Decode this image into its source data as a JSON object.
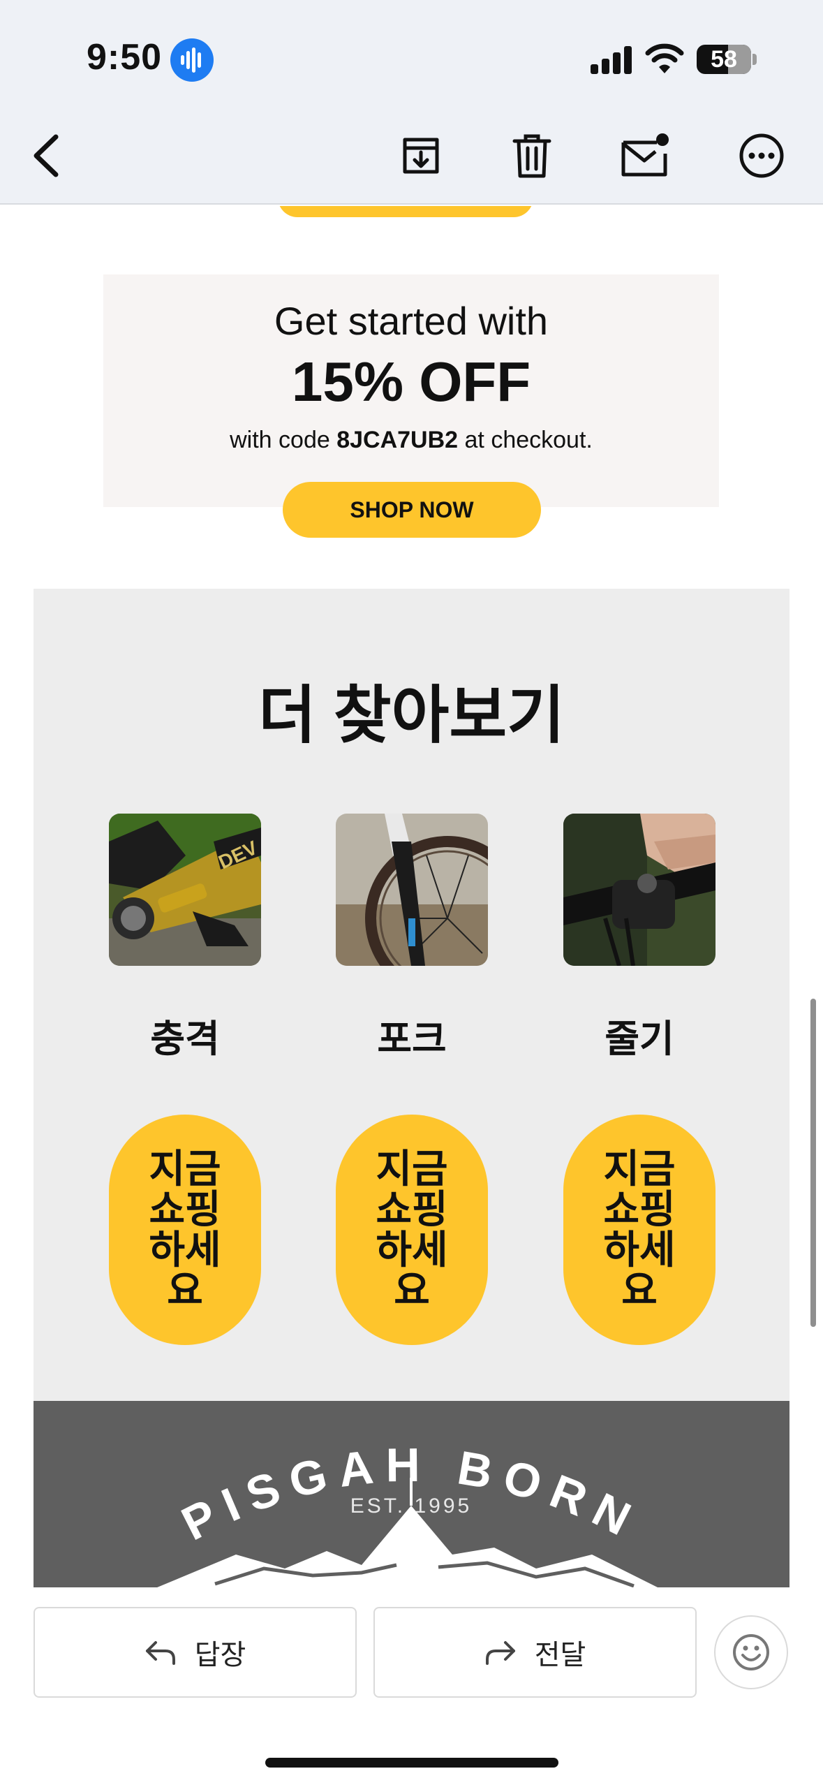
{
  "status_bar": {
    "time": "9:50",
    "battery": "58",
    "battery_level": 0.58
  },
  "toolbar": {
    "back_icon": "chevron-left-icon",
    "archive_icon": "archive-icon",
    "trash_icon": "trash-icon",
    "mark_unread_icon": "mail-unread-icon",
    "more_icon": "more-icon"
  },
  "email": {
    "promo": {
      "line1": "Get started with",
      "headline": "15% OFF",
      "code_prefix": "with code ",
      "code": "8JCA7UB2",
      "code_suffix": " at checkout.",
      "cta": "SHOP NOW"
    },
    "explore": {
      "title": "더 찾아보기",
      "categories": [
        {
          "label": "충격",
          "button": "지금 쇼핑하세요",
          "image": "shock-absorber-photo"
        },
        {
          "label": "포크",
          "button": "지금 쇼핑하세요",
          "image": "bike-fork-photo"
        },
        {
          "label": "줄기",
          "button": "지금 쇼핑하세요",
          "image": "bike-stem-photo"
        }
      ]
    },
    "footer_logo": {
      "text": "PISGAH BORN",
      "est": "EST. 1995"
    }
  },
  "reply_bar": {
    "reply": "답장",
    "forward": "전달"
  },
  "colors": {
    "accent_yellow": "#fec52c",
    "promo_bg": "#f7f4f3",
    "explore_bg": "#ededed",
    "footer_bg": "#5f5f5f",
    "toolbar_bg": "#eef1f6",
    "recording_blue": "#1e7cf2"
  }
}
